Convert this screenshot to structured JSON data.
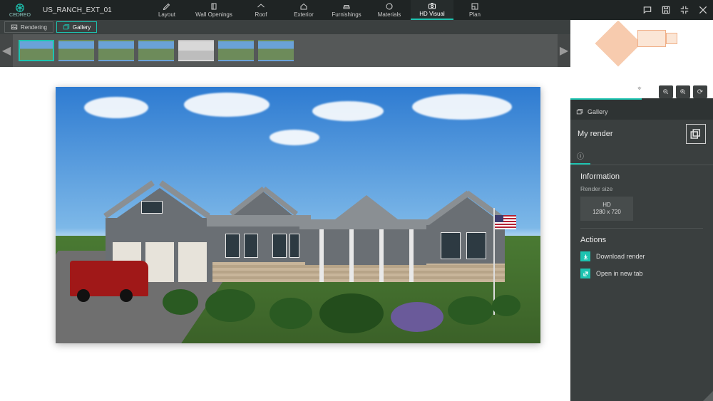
{
  "brand": "CEDREO",
  "project_name": "US_RANCH_EXT_01",
  "tools": [
    {
      "label": "Layout"
    },
    {
      "label": "Wall Openings"
    },
    {
      "label": "Roof"
    },
    {
      "label": "Exterior"
    },
    {
      "label": "Furnishings"
    },
    {
      "label": "Materials"
    },
    {
      "label": "HD Visual"
    },
    {
      "label": "Plan"
    }
  ],
  "subtabs": {
    "rendering": "Rendering",
    "gallery": "Gallery"
  },
  "inspector": {
    "gallery_label": "Gallery",
    "title": "My render",
    "info_heading": "Information",
    "render_size_label": "Render size",
    "size_name": "HD",
    "size_value": "1280 x 720",
    "actions_heading": "Actions",
    "download": "Download render",
    "open": "Open in new tab"
  }
}
